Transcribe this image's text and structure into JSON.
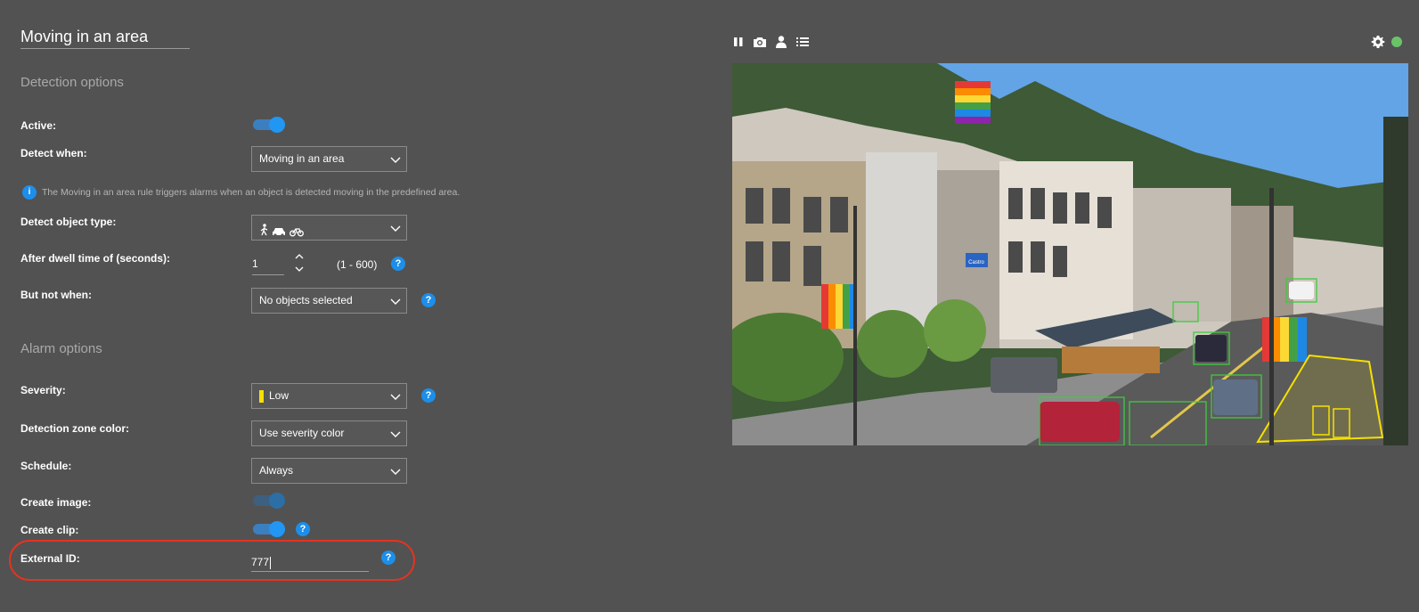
{
  "rule_name": "Moving in an area",
  "detection": {
    "section_title": "Detection options",
    "active_label": "Active:",
    "active_on": true,
    "detect_when_label": "Detect when:",
    "detect_when_value": "Moving in an area",
    "info_text": "The Moving in an area rule triggers alarms when an object is detected moving in the predefined area.",
    "object_type_label": "Detect object type:",
    "object_type_icons": [
      "person-icon",
      "car-icon",
      "bike-icon"
    ],
    "dwell_label": "After dwell time of (seconds):",
    "dwell_value": "1",
    "dwell_range": "(1 - 600)",
    "but_not_label": "But not when:",
    "but_not_value": "No objects selected"
  },
  "alarm": {
    "section_title": "Alarm options",
    "severity_label": "Severity:",
    "severity_value": "Low",
    "severity_color": "#f5e100",
    "zone_color_label": "Detection zone color:",
    "zone_color_value": "Use severity color",
    "schedule_label": "Schedule:",
    "schedule_value": "Always",
    "create_image_label": "Create image:",
    "create_image_on": true,
    "create_clip_label": "Create clip:",
    "create_clip_on": true,
    "external_id_label": "External ID:",
    "external_id_value": "777"
  },
  "toolbar": {
    "icons": [
      "pause-icon",
      "camera-icon",
      "person-icon",
      "list-icon",
      "gear-icon"
    ],
    "status_color": "#6ac36a"
  },
  "video": {
    "street_sign": "Castro"
  },
  "colors": {
    "accent": "#2196f3",
    "highlight": "#e5331f",
    "background": "#525252"
  }
}
